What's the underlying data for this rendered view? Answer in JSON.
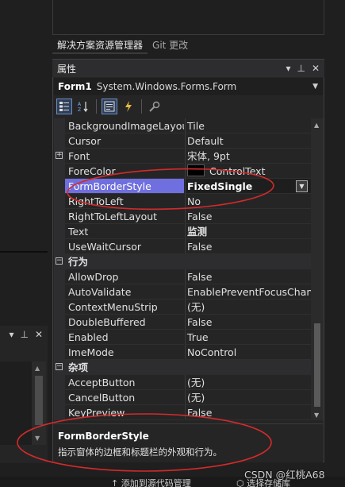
{
  "solution_explorer": {
    "tabs": [
      "解决方案资源管理器",
      "Git 更改"
    ]
  },
  "window_controls": {
    "dropdown": "▾",
    "pin": "⊥",
    "close": "✕"
  },
  "properties_window": {
    "title": "属性",
    "object_name": "Form1",
    "object_type": "System.Windows.Forms.Form",
    "toolbar": {
      "categorized": "categorized-icon",
      "alphabetical": "alphabetical-icon",
      "properties": "properties-icon",
      "events": "events-icon",
      "property_pages": "property-pages-icon"
    },
    "rows": [
      {
        "name": "BackgroundImageLayout",
        "value": "Tile"
      },
      {
        "name": "Cursor",
        "value": "Default"
      },
      {
        "name": "Font",
        "value": "宋体, 9pt",
        "expander": "+"
      },
      {
        "name": "ForeColor",
        "value": "ControlText",
        "swatch": "#000000"
      },
      {
        "name": "FormBorderStyle",
        "value": "FixedSingle",
        "selected": true
      },
      {
        "name": "RightToLeft",
        "value": "No"
      },
      {
        "name": "RightToLeftLayout",
        "value": "False"
      },
      {
        "name": "Text",
        "value": "监测",
        "bold": true
      },
      {
        "name": "UseWaitCursor",
        "value": "False"
      },
      {
        "category": "行为",
        "expander": "−"
      },
      {
        "name": "AllowDrop",
        "value": "False"
      },
      {
        "name": "AutoValidate",
        "value": "EnablePreventFocusChange"
      },
      {
        "name": "ContextMenuStrip",
        "value": "(无)"
      },
      {
        "name": "DoubleBuffered",
        "value": "False"
      },
      {
        "name": "Enabled",
        "value": "True"
      },
      {
        "name": "ImeMode",
        "value": "NoControl"
      },
      {
        "category": "杂项",
        "expander": "−"
      },
      {
        "name": "AcceptButton",
        "value": "(无)"
      },
      {
        "name": "CancelButton",
        "value": "(无)"
      },
      {
        "name": "KeyPreview",
        "value": "False"
      }
    ],
    "description": {
      "title": "FormBorderStyle",
      "text": "指示窗体的边框和标题栏的外观和行为。"
    }
  },
  "status_bar": {
    "item1": "↑ 添加到源代码管理",
    "item2": "⬡ 选择存储库"
  },
  "watermark": "CSDN @红桃A68",
  "colors": {
    "selection": "#6f6fdf",
    "annotation": "#d42a2a",
    "background": "#252526"
  }
}
